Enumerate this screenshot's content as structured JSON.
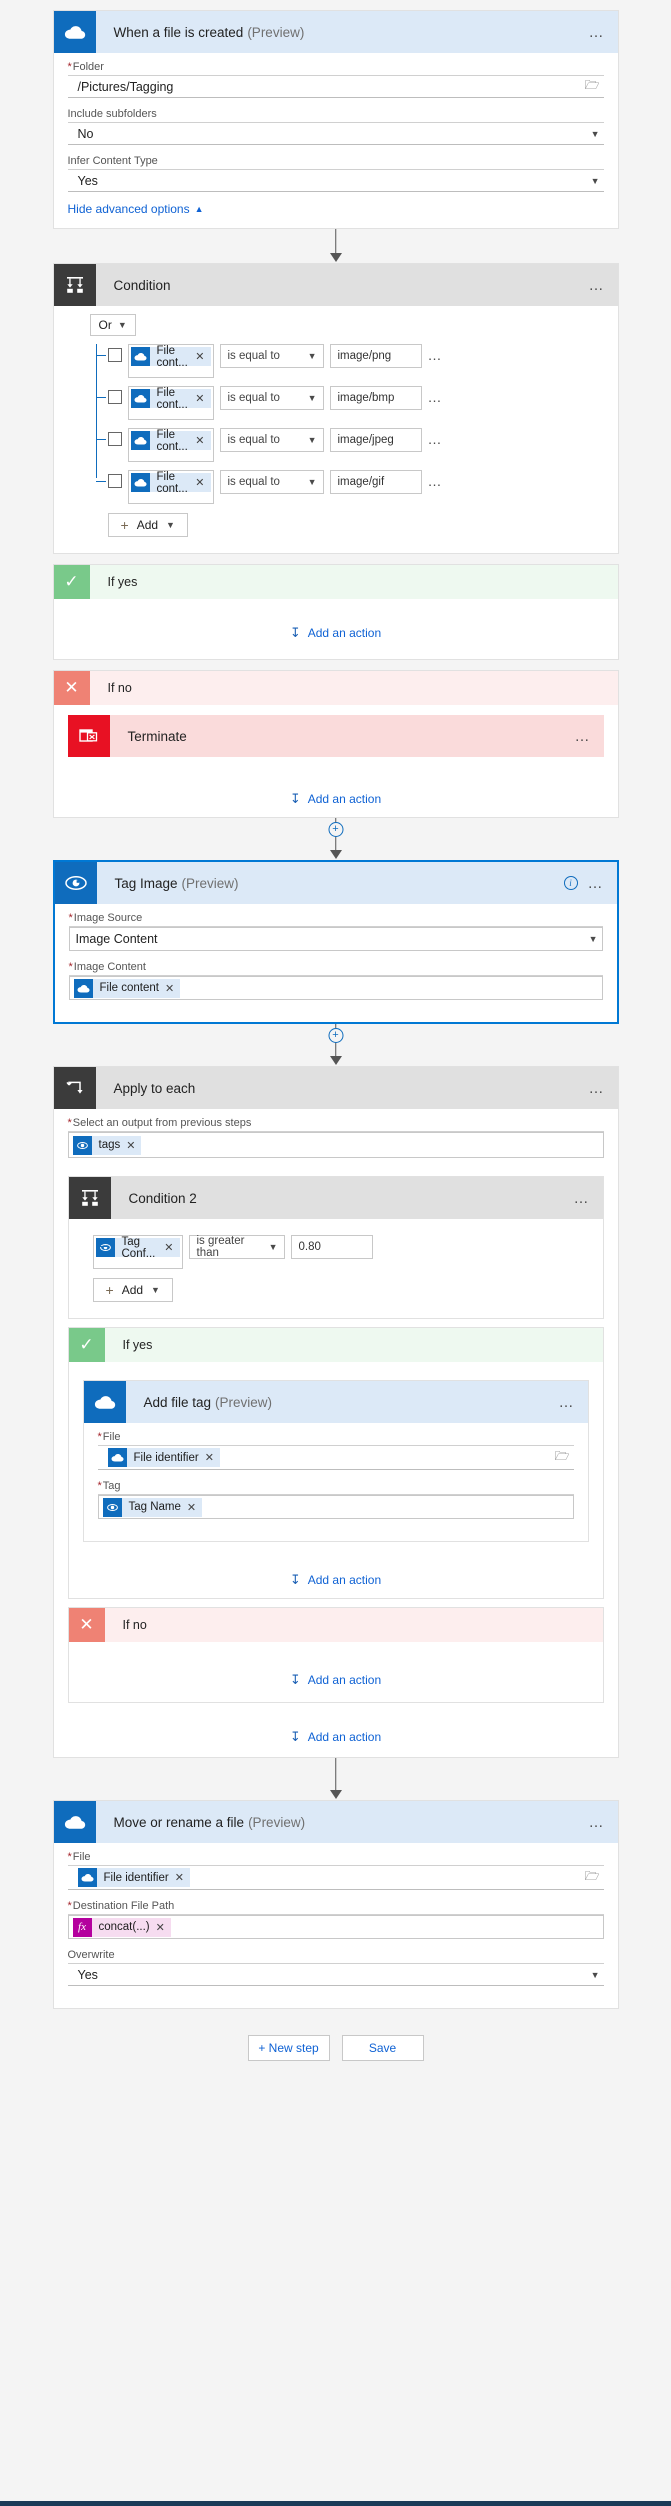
{
  "trigger": {
    "title": "When a file is created",
    "preview": "(Preview)",
    "fields": [
      {
        "label": "Folder",
        "required": true,
        "value": "/Pictures/Tagging",
        "control": "folder-picker"
      },
      {
        "label": "Include subfolders",
        "required": false,
        "value": "No",
        "control": "dropdown"
      },
      {
        "label": "Infer Content Type",
        "required": false,
        "value": "Yes",
        "control": "dropdown"
      }
    ],
    "advanced_link": "Hide advanced options",
    "icon": "onedrive-cloud-icon",
    "more_menu": "…"
  },
  "condition": {
    "title": "Condition",
    "icon": "condition-branch-icon",
    "logic_operator": "Or",
    "add_label": "Add",
    "rows": [
      {
        "token": "File cont...",
        "operator": "is equal to",
        "value": "image/png"
      },
      {
        "token": "File cont...",
        "operator": "is equal to",
        "value": "image/bmp"
      },
      {
        "token": "File cont...",
        "operator": "is equal to",
        "value": "image/jpeg"
      },
      {
        "token": "File cont...",
        "operator": "is equal to",
        "value": "image/gif"
      }
    ],
    "yes_branch": {
      "label": "If yes",
      "add_action": "Add an action",
      "actions": []
    },
    "no_branch": {
      "label": "If no",
      "add_action": "Add an action",
      "actions": [
        {
          "title": "Terminate",
          "icon": "terminate-icon"
        }
      ]
    }
  },
  "tag_image": {
    "title": "Tag Image",
    "preview": "(Preview)",
    "icon": "computer-vision-eye-icon",
    "fields": [
      {
        "label": "Image Source",
        "required": true,
        "value": "Image Content",
        "control": "dropdown"
      },
      {
        "label": "Image Content",
        "required": true,
        "token": "File content",
        "control": "token"
      }
    ]
  },
  "apply_to_each": {
    "title": "Apply to each",
    "icon": "loop-icon",
    "select_label": "Select an output from previous steps",
    "select_token": "tags",
    "add_action": "Add an action",
    "condition2": {
      "title": "Condition 2",
      "icon": "condition-branch-icon",
      "add_label": "Add",
      "rows": [
        {
          "token": "Tag Conf...",
          "operator": "is greater than",
          "value": "0.80"
        }
      ],
      "yes_branch": {
        "label": "If yes",
        "add_action": "Add an action",
        "action": {
          "title": "Add file tag",
          "preview": "(Preview)",
          "icon": "onedrive-cloud-icon",
          "fields": [
            {
              "label": "File",
              "required": true,
              "token": "File identifier",
              "control": "token-folder"
            },
            {
              "label": "Tag",
              "required": true,
              "token": "Tag Name",
              "control": "token"
            }
          ]
        }
      },
      "no_branch": {
        "label": "If no",
        "add_action": "Add an action"
      }
    }
  },
  "move_file": {
    "title": "Move or rename a file",
    "preview": "(Preview)",
    "icon": "onedrive-cloud-icon",
    "fields": [
      {
        "label": "File",
        "required": true,
        "token": "File identifier",
        "control": "token-folder"
      },
      {
        "label": "Destination File Path",
        "required": true,
        "token": "concat(...)",
        "control": "expression-token"
      },
      {
        "label": "Overwrite",
        "required": false,
        "value": "Yes",
        "control": "dropdown"
      }
    ]
  },
  "footer": {
    "new_step": "+ New step",
    "save": "Save"
  },
  "colors": {
    "accent": "#0f6cbd",
    "header_blue": "#dce9f7",
    "yes_green": "#79c98a",
    "no_red": "#ef8274",
    "terminate_red": "#e81123",
    "expression_magenta": "#b4009e"
  }
}
